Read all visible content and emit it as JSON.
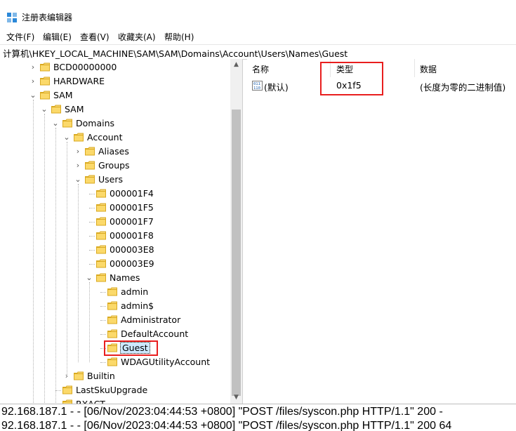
{
  "window": {
    "title": "注册表编辑器"
  },
  "menu": [
    "文件(F)",
    "编辑(E)",
    "查看(V)",
    "收藏夹(A)",
    "帮助(H)"
  ],
  "address": "计算机\\HKEY_LOCAL_MACHINE\\SAM\\SAM\\Domains\\Account\\Users\\Names\\Guest",
  "tree": [
    {
      "label": "BCD00000000",
      "level": 0,
      "twisty": "›"
    },
    {
      "label": "HARDWARE",
      "level": 0,
      "twisty": "›"
    },
    {
      "label": "SAM",
      "level": 0,
      "twisty": "⌄"
    },
    {
      "label": "SAM",
      "level": 1,
      "twisty": "⌄"
    },
    {
      "label": "Domains",
      "level": 2,
      "twisty": "⌄"
    },
    {
      "label": "Account",
      "level": 3,
      "twisty": "⌄"
    },
    {
      "label": "Aliases",
      "level": 4,
      "twisty": "›"
    },
    {
      "label": "Groups",
      "level": 4,
      "twisty": "›"
    },
    {
      "label": "Users",
      "level": 4,
      "twisty": "⌄"
    },
    {
      "label": "000001F4",
      "level": 5,
      "twisty": ""
    },
    {
      "label": "000001F5",
      "level": 5,
      "twisty": ""
    },
    {
      "label": "000001F7",
      "level": 5,
      "twisty": ""
    },
    {
      "label": "000001F8",
      "level": 5,
      "twisty": ""
    },
    {
      "label": "000003E8",
      "level": 5,
      "twisty": ""
    },
    {
      "label": "000003E9",
      "level": 5,
      "twisty": ""
    },
    {
      "label": "Names",
      "level": 5,
      "twisty": "⌄"
    },
    {
      "label": "admin",
      "level": 6,
      "twisty": ""
    },
    {
      "label": "admin$",
      "level": 6,
      "twisty": ""
    },
    {
      "label": "Administrator",
      "level": 6,
      "twisty": ""
    },
    {
      "label": "DefaultAccount",
      "level": 6,
      "twisty": ""
    },
    {
      "label": "Guest",
      "level": 6,
      "twisty": "",
      "selected": true
    },
    {
      "label": "WDAGUtilityAccount",
      "level": 6,
      "twisty": ""
    },
    {
      "label": "Builtin",
      "level": 3,
      "twisty": "›"
    },
    {
      "label": "LastSkuUpgrade",
      "level": 2,
      "twisty": ""
    },
    {
      "label": "RXACT",
      "level": 2,
      "twisty": ""
    }
  ],
  "values": {
    "headers": {
      "name": "名称",
      "type": "类型",
      "data": "数据"
    },
    "rows": [
      {
        "name": "(默认)",
        "type": "0x1f5",
        "data": "(长度为零的二进制值)",
        "icon": "binary-value-icon"
      }
    ]
  },
  "console": [
    "92.168.187.1 - - [06/Nov/2023:04:44:53 +0800] \"POST /files/syscon.php HTTP/1.1\" 200 -",
    "92.168.187.1 - - [06/Nov/2023:04:44:53 +0800] \"POST /files/syscon.php HTTP/1.1\" 200 64"
  ],
  "colors": {
    "highlight": "#e81e1e",
    "folder": "#f5c842",
    "selection": "#cce8ff"
  }
}
